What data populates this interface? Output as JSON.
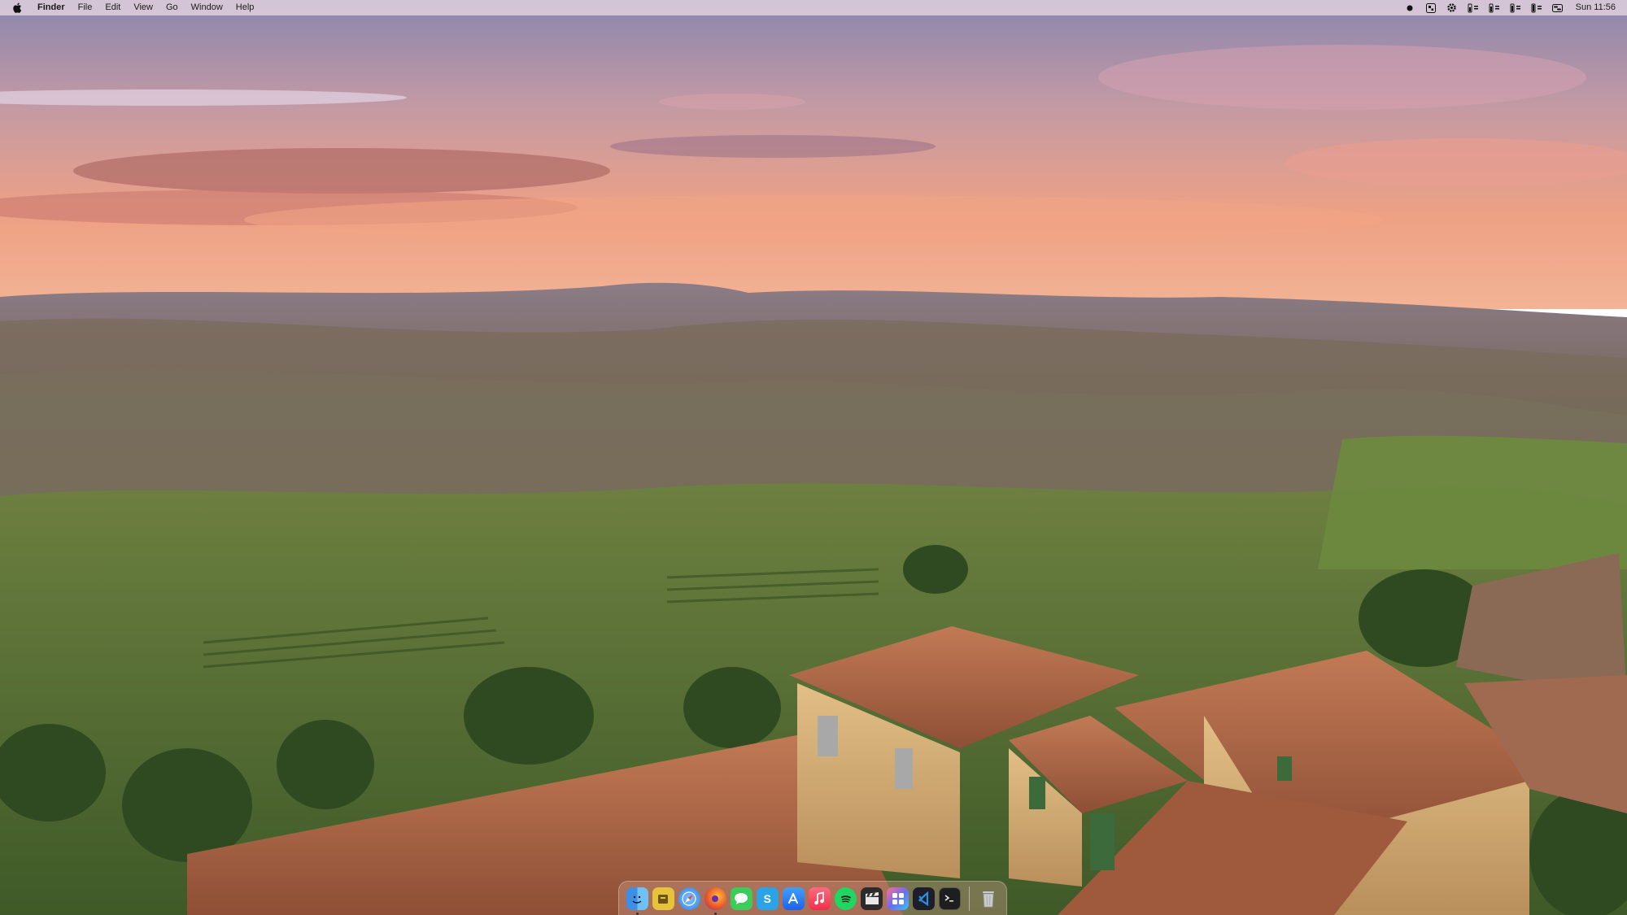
{
  "menubar": {
    "app_name": "Finder",
    "menus": [
      "File",
      "Edit",
      "View",
      "Go",
      "Window",
      "Help"
    ],
    "status_icons": [
      "record-icon",
      "grid-icon",
      "gear-icon",
      "battery-icon",
      "battery-icon",
      "battery-icon",
      "battery-icon",
      "control-center-icon"
    ],
    "clock": "Sun 11:56"
  },
  "dock": {
    "apps": [
      {
        "name": "finder",
        "color": "#4aa3f0",
        "running": true
      },
      {
        "name": "archive",
        "color": "#e6c33b",
        "running": false
      },
      {
        "name": "safari",
        "color": "#3a8ef0",
        "running": false
      },
      {
        "name": "firefox",
        "color": "#e8602a",
        "running": true
      },
      {
        "name": "messages",
        "color": "#3ccc5a",
        "running": false
      },
      {
        "name": "skype",
        "color": "#2aa3e8",
        "running": false
      },
      {
        "name": "app-store",
        "color": "#2f7df6",
        "running": false
      },
      {
        "name": "music",
        "color": "#f3455a",
        "running": false
      },
      {
        "name": "spotify",
        "color": "#1ed760",
        "running": false
      },
      {
        "name": "final-cut",
        "color": "#2b2b2b",
        "running": false
      },
      {
        "name": "launchpad",
        "color": "#6b6bf0",
        "running": false
      },
      {
        "name": "vscode",
        "color": "#2b8fe0",
        "running": false
      },
      {
        "name": "terminal",
        "color": "#1e1e1e",
        "running": false
      }
    ],
    "trash": {
      "name": "trash",
      "color": "#b8bcc4"
    }
  },
  "wallpaper": {
    "sky_top": "#7f7ea6",
    "sky_glow": "#f2a07e",
    "hills": "#7a6a60",
    "fields": "#5f7a3c",
    "roofs": "#b0684a",
    "walls": "#d8b27a"
  }
}
